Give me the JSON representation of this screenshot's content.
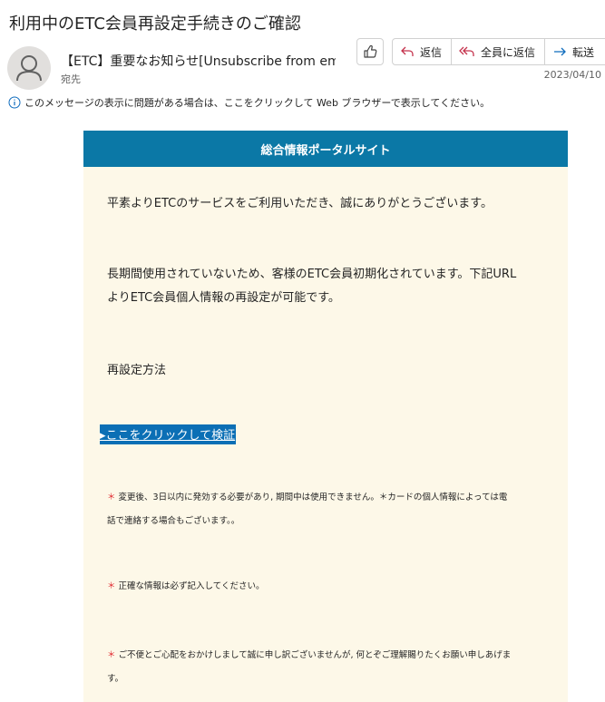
{
  "subject": "利用中のETC会員再設定手続きのご確認",
  "sender": "【ETC】重要なお知らせ[Unsubscribe from email]",
  "to_label": "宛先",
  "date": "2023/04/10",
  "actions": {
    "reply": "返信",
    "reply_all": "全員に返信",
    "forward": "転送"
  },
  "info_bar": "このメッセージの表示に問題がある場合は、ここをクリックして Web ブラウザーで表示してください。",
  "card": {
    "header": "総合情報ポータルサイト",
    "greeting": "平素よりETCのサービスをご利用いただき、誠にありがとうございます。",
    "body_line1": "長期間使用されていないため、客様のETC会員初期化されています。下記URL",
    "body_line2": "よりETC会員個人情報の再設定が可能です。",
    "method_heading": "再設定方法",
    "link_text": "▸ここをクリックして検証",
    "note_star": "＊",
    "note1_line1": "変更後、3日以内に発効する必要があり, 期間中は使用できません。＊カードの個人情報によっては電",
    "note1_line2": "話で連絡する場合もございます。。",
    "note2": "正確な情報は必ず記入してください。",
    "note3_line1": "ご不便とご心配をおかけしまして誠に申し訳ございませんが, 何とぞご理解賜りたくお願い申しあげま",
    "note3_line2": "す。"
  },
  "colors": {
    "header_bg": "#0b78a6",
    "card_bg": "#fdf8e8",
    "link_bg": "#0b6fb5",
    "star": "#e0282e",
    "reply_icon": "#c4314b",
    "forward_icon": "#0f6cbd"
  }
}
